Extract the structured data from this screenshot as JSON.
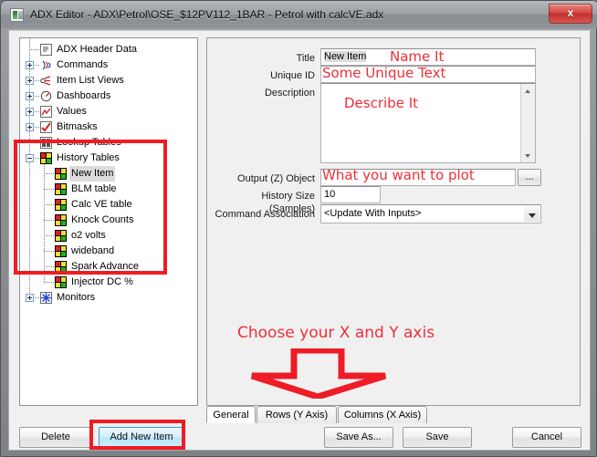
{
  "window": {
    "title": "ADX Editor - ADX\\Petrol\\OSE_$12PV112_1BAR - Petrol with calcVE.adx",
    "close_label": "x",
    "app_icon": "adx-app-icon"
  },
  "tree": {
    "nodes": [
      {
        "label": "ADX Header Data",
        "level": 0,
        "icon": "header-data-icon",
        "expander": "none"
      },
      {
        "label": "Commands",
        "level": 0,
        "icon": "commands-icon",
        "expander": "plus"
      },
      {
        "label": "Item List Views",
        "level": 0,
        "icon": "item-list-views-icon",
        "expander": "plus"
      },
      {
        "label": "Dashboards",
        "level": 0,
        "icon": "dashboards-icon",
        "expander": "plus"
      },
      {
        "label": "Values",
        "level": 0,
        "icon": "values-icon",
        "expander": "plus"
      },
      {
        "label": "Bitmasks",
        "level": 0,
        "icon": "bitmasks-icon",
        "expander": "plus"
      },
      {
        "label": "Lookup Tables",
        "level": 0,
        "icon": "lookup-tables-icon",
        "expander": "none"
      },
      {
        "label": "History Tables",
        "level": 0,
        "icon": "history-tables-icon",
        "expander": "minus"
      },
      {
        "label": "New Item",
        "level": 1,
        "icon": "history-table-icon",
        "selected": true
      },
      {
        "label": "BLM table",
        "level": 1,
        "icon": "history-table-icon"
      },
      {
        "label": "Calc VE table",
        "level": 1,
        "icon": "history-table-icon"
      },
      {
        "label": "Knock Counts",
        "level": 1,
        "icon": "history-table-icon"
      },
      {
        "label": "o2 volts",
        "level": 1,
        "icon": "history-table-icon"
      },
      {
        "label": "wideband",
        "level": 1,
        "icon": "history-table-icon"
      },
      {
        "label": "Spark Advance",
        "level": 1,
        "icon": "history-table-icon"
      },
      {
        "label": "Injector DC %",
        "level": 1,
        "icon": "history-table-icon"
      },
      {
        "label": "Monitors",
        "level": 0,
        "icon": "monitors-icon",
        "expander": "plus"
      }
    ]
  },
  "form": {
    "title": {
      "label": "Title",
      "value": "New Item"
    },
    "unique_id": {
      "label": "Unique ID",
      "value": ""
    },
    "description": {
      "label": "Description",
      "value": ""
    },
    "output_object": {
      "label": "Output (Z) Object",
      "value": "",
      "browse_label": "..."
    },
    "history_size": {
      "label": "History Size (Samples)",
      "value": "10"
    },
    "command_association": {
      "label": "Command Association",
      "value": "<Update With Inputs>"
    }
  },
  "tabs": [
    {
      "label": "General",
      "active": true
    },
    {
      "label": "Rows (Y Axis)",
      "active": false
    },
    {
      "label": "Columns (X Axis)",
      "active": false
    }
  ],
  "buttons": {
    "delete": "Delete",
    "add_new_item": "Add New Item",
    "save_as": "Save As...",
    "save": "Save",
    "cancel": "Cancel"
  },
  "annotations": {
    "name_it": "Name It",
    "some_unique_text": "Some Unique Text",
    "describe_it": "Describe It",
    "what_to_plot": "What you want to plot",
    "choose_axis": "Choose your X and Y axis",
    "accent_color": "#ee1c25",
    "arrow": "down-arrow-annotation"
  }
}
